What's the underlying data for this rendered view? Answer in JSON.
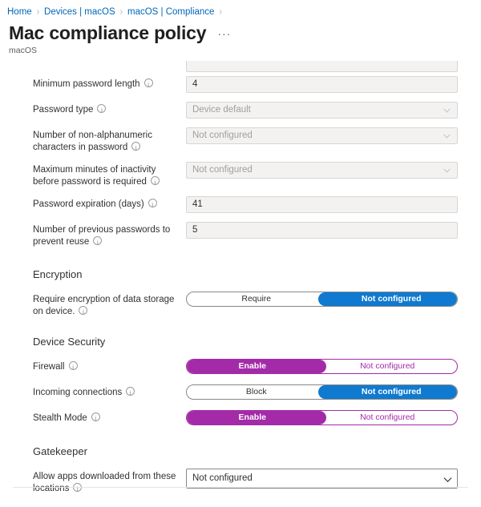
{
  "breadcrumb": {
    "items": [
      "Home",
      "Devices | macOS",
      "macOS | Compliance"
    ],
    "separator": "›"
  },
  "header": {
    "title": "Mac compliance policy",
    "subtitle": "macOS",
    "more_label": "···"
  },
  "password_section": {
    "rows": [
      {
        "label": "Minimum password length",
        "value": "4",
        "kind": "text",
        "placeholder": ""
      },
      {
        "label": "Password type",
        "value": "Device default",
        "kind": "select"
      },
      {
        "label": "Number of non-alphanumeric characters in password",
        "value": "Not configured",
        "kind": "select"
      },
      {
        "label": "Maximum minutes of inactivity before password is required",
        "value": "Not configured",
        "kind": "select"
      },
      {
        "label": "Password expiration (days)",
        "value": "41",
        "kind": "text"
      },
      {
        "label": "Number of previous passwords to prevent reuse",
        "value": "5",
        "kind": "text"
      }
    ]
  },
  "encryption_section": {
    "heading": "Encryption",
    "rows": [
      {
        "label": "Require encryption of data storage on device.",
        "option_left": "Require",
        "option_right": "Not configured",
        "selected": "right",
        "accent": "blue"
      }
    ]
  },
  "device_security_section": {
    "heading": "Device Security",
    "rows": [
      {
        "label": "Firewall",
        "option_left": "Enable",
        "option_right": "Not configured",
        "selected": "left",
        "accent": "purple"
      },
      {
        "label": "Incoming connections",
        "option_left": "Block",
        "option_right": "Not configured",
        "selected": "right",
        "accent": "blue"
      },
      {
        "label": "Stealth Mode",
        "option_left": "Enable",
        "option_right": "Not configured",
        "selected": "left",
        "accent": "purple"
      }
    ]
  },
  "gatekeeper_section": {
    "heading": "Gatekeeper",
    "rows": [
      {
        "label": "Allow apps downloaded from these locations",
        "value": "Not configured",
        "kind": "select"
      }
    ]
  },
  "colors": {
    "link": "#0067b8",
    "accent_blue": "#0f7ad0",
    "accent_purple": "#a32ba8",
    "field_bg": "#f3f2f1",
    "field_border": "#d8d6d4",
    "text": "#323130",
    "muted_text": "#a19f9d"
  }
}
